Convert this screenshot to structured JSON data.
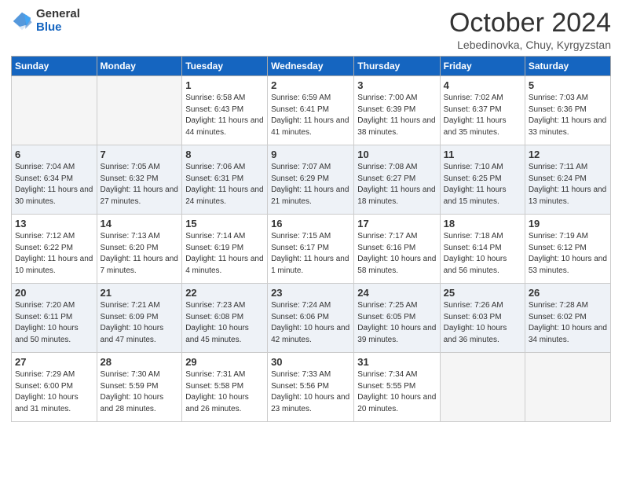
{
  "header": {
    "logo_general": "General",
    "logo_blue": "Blue",
    "month_title": "October 2024",
    "location": "Lebedinovka, Chuy, Kyrgyzstan"
  },
  "days_of_week": [
    "Sunday",
    "Monday",
    "Tuesday",
    "Wednesday",
    "Thursday",
    "Friday",
    "Saturday"
  ],
  "weeks": [
    [
      {
        "day": "",
        "sunrise": "",
        "sunset": "",
        "daylight": ""
      },
      {
        "day": "",
        "sunrise": "",
        "sunset": "",
        "daylight": ""
      },
      {
        "day": "1",
        "sunrise": "Sunrise: 6:58 AM",
        "sunset": "Sunset: 6:43 PM",
        "daylight": "Daylight: 11 hours and 44 minutes."
      },
      {
        "day": "2",
        "sunrise": "Sunrise: 6:59 AM",
        "sunset": "Sunset: 6:41 PM",
        "daylight": "Daylight: 11 hours and 41 minutes."
      },
      {
        "day": "3",
        "sunrise": "Sunrise: 7:00 AM",
        "sunset": "Sunset: 6:39 PM",
        "daylight": "Daylight: 11 hours and 38 minutes."
      },
      {
        "day": "4",
        "sunrise": "Sunrise: 7:02 AM",
        "sunset": "Sunset: 6:37 PM",
        "daylight": "Daylight: 11 hours and 35 minutes."
      },
      {
        "day": "5",
        "sunrise": "Sunrise: 7:03 AM",
        "sunset": "Sunset: 6:36 PM",
        "daylight": "Daylight: 11 hours and 33 minutes."
      }
    ],
    [
      {
        "day": "6",
        "sunrise": "Sunrise: 7:04 AM",
        "sunset": "Sunset: 6:34 PM",
        "daylight": "Daylight: 11 hours and 30 minutes."
      },
      {
        "day": "7",
        "sunrise": "Sunrise: 7:05 AM",
        "sunset": "Sunset: 6:32 PM",
        "daylight": "Daylight: 11 hours and 27 minutes."
      },
      {
        "day": "8",
        "sunrise": "Sunrise: 7:06 AM",
        "sunset": "Sunset: 6:31 PM",
        "daylight": "Daylight: 11 hours and 24 minutes."
      },
      {
        "day": "9",
        "sunrise": "Sunrise: 7:07 AM",
        "sunset": "Sunset: 6:29 PM",
        "daylight": "Daylight: 11 hours and 21 minutes."
      },
      {
        "day": "10",
        "sunrise": "Sunrise: 7:08 AM",
        "sunset": "Sunset: 6:27 PM",
        "daylight": "Daylight: 11 hours and 18 minutes."
      },
      {
        "day": "11",
        "sunrise": "Sunrise: 7:10 AM",
        "sunset": "Sunset: 6:25 PM",
        "daylight": "Daylight: 11 hours and 15 minutes."
      },
      {
        "day": "12",
        "sunrise": "Sunrise: 7:11 AM",
        "sunset": "Sunset: 6:24 PM",
        "daylight": "Daylight: 11 hours and 13 minutes."
      }
    ],
    [
      {
        "day": "13",
        "sunrise": "Sunrise: 7:12 AM",
        "sunset": "Sunset: 6:22 PM",
        "daylight": "Daylight: 11 hours and 10 minutes."
      },
      {
        "day": "14",
        "sunrise": "Sunrise: 7:13 AM",
        "sunset": "Sunset: 6:20 PM",
        "daylight": "Daylight: 11 hours and 7 minutes."
      },
      {
        "day": "15",
        "sunrise": "Sunrise: 7:14 AM",
        "sunset": "Sunset: 6:19 PM",
        "daylight": "Daylight: 11 hours and 4 minutes."
      },
      {
        "day": "16",
        "sunrise": "Sunrise: 7:15 AM",
        "sunset": "Sunset: 6:17 PM",
        "daylight": "Daylight: 11 hours and 1 minute."
      },
      {
        "day": "17",
        "sunrise": "Sunrise: 7:17 AM",
        "sunset": "Sunset: 6:16 PM",
        "daylight": "Daylight: 10 hours and 58 minutes."
      },
      {
        "day": "18",
        "sunrise": "Sunrise: 7:18 AM",
        "sunset": "Sunset: 6:14 PM",
        "daylight": "Daylight: 10 hours and 56 minutes."
      },
      {
        "day": "19",
        "sunrise": "Sunrise: 7:19 AM",
        "sunset": "Sunset: 6:12 PM",
        "daylight": "Daylight: 10 hours and 53 minutes."
      }
    ],
    [
      {
        "day": "20",
        "sunrise": "Sunrise: 7:20 AM",
        "sunset": "Sunset: 6:11 PM",
        "daylight": "Daylight: 10 hours and 50 minutes."
      },
      {
        "day": "21",
        "sunrise": "Sunrise: 7:21 AM",
        "sunset": "Sunset: 6:09 PM",
        "daylight": "Daylight: 10 hours and 47 minutes."
      },
      {
        "day": "22",
        "sunrise": "Sunrise: 7:23 AM",
        "sunset": "Sunset: 6:08 PM",
        "daylight": "Daylight: 10 hours and 45 minutes."
      },
      {
        "day": "23",
        "sunrise": "Sunrise: 7:24 AM",
        "sunset": "Sunset: 6:06 PM",
        "daylight": "Daylight: 10 hours and 42 minutes."
      },
      {
        "day": "24",
        "sunrise": "Sunrise: 7:25 AM",
        "sunset": "Sunset: 6:05 PM",
        "daylight": "Daylight: 10 hours and 39 minutes."
      },
      {
        "day": "25",
        "sunrise": "Sunrise: 7:26 AM",
        "sunset": "Sunset: 6:03 PM",
        "daylight": "Daylight: 10 hours and 36 minutes."
      },
      {
        "day": "26",
        "sunrise": "Sunrise: 7:28 AM",
        "sunset": "Sunset: 6:02 PM",
        "daylight": "Daylight: 10 hours and 34 minutes."
      }
    ],
    [
      {
        "day": "27",
        "sunrise": "Sunrise: 7:29 AM",
        "sunset": "Sunset: 6:00 PM",
        "daylight": "Daylight: 10 hours and 31 minutes."
      },
      {
        "day": "28",
        "sunrise": "Sunrise: 7:30 AM",
        "sunset": "Sunset: 5:59 PM",
        "daylight": "Daylight: 10 hours and 28 minutes."
      },
      {
        "day": "29",
        "sunrise": "Sunrise: 7:31 AM",
        "sunset": "Sunset: 5:58 PM",
        "daylight": "Daylight: 10 hours and 26 minutes."
      },
      {
        "day": "30",
        "sunrise": "Sunrise: 7:33 AM",
        "sunset": "Sunset: 5:56 PM",
        "daylight": "Daylight: 10 hours and 23 minutes."
      },
      {
        "day": "31",
        "sunrise": "Sunrise: 7:34 AM",
        "sunset": "Sunset: 5:55 PM",
        "daylight": "Daylight: 10 hours and 20 minutes."
      },
      {
        "day": "",
        "sunrise": "",
        "sunset": "",
        "daylight": ""
      },
      {
        "day": "",
        "sunrise": "",
        "sunset": "",
        "daylight": ""
      }
    ]
  ]
}
